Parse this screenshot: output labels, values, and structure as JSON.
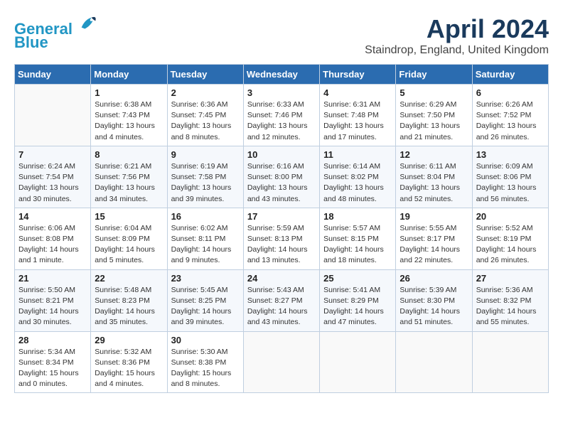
{
  "header": {
    "logo_line1": "General",
    "logo_line2": "Blue",
    "month_title": "April 2024",
    "location": "Staindrop, England, United Kingdom"
  },
  "weekdays": [
    "Sunday",
    "Monday",
    "Tuesday",
    "Wednesday",
    "Thursday",
    "Friday",
    "Saturday"
  ],
  "weeks": [
    [
      {
        "day": "",
        "info": ""
      },
      {
        "day": "1",
        "info": "Sunrise: 6:38 AM\nSunset: 7:43 PM\nDaylight: 13 hours\nand 4 minutes."
      },
      {
        "day": "2",
        "info": "Sunrise: 6:36 AM\nSunset: 7:45 PM\nDaylight: 13 hours\nand 8 minutes."
      },
      {
        "day": "3",
        "info": "Sunrise: 6:33 AM\nSunset: 7:46 PM\nDaylight: 13 hours\nand 12 minutes."
      },
      {
        "day": "4",
        "info": "Sunrise: 6:31 AM\nSunset: 7:48 PM\nDaylight: 13 hours\nand 17 minutes."
      },
      {
        "day": "5",
        "info": "Sunrise: 6:29 AM\nSunset: 7:50 PM\nDaylight: 13 hours\nand 21 minutes."
      },
      {
        "day": "6",
        "info": "Sunrise: 6:26 AM\nSunset: 7:52 PM\nDaylight: 13 hours\nand 26 minutes."
      }
    ],
    [
      {
        "day": "7",
        "info": "Sunrise: 6:24 AM\nSunset: 7:54 PM\nDaylight: 13 hours\nand 30 minutes."
      },
      {
        "day": "8",
        "info": "Sunrise: 6:21 AM\nSunset: 7:56 PM\nDaylight: 13 hours\nand 34 minutes."
      },
      {
        "day": "9",
        "info": "Sunrise: 6:19 AM\nSunset: 7:58 PM\nDaylight: 13 hours\nand 39 minutes."
      },
      {
        "day": "10",
        "info": "Sunrise: 6:16 AM\nSunset: 8:00 PM\nDaylight: 13 hours\nand 43 minutes."
      },
      {
        "day": "11",
        "info": "Sunrise: 6:14 AM\nSunset: 8:02 PM\nDaylight: 13 hours\nand 48 minutes."
      },
      {
        "day": "12",
        "info": "Sunrise: 6:11 AM\nSunset: 8:04 PM\nDaylight: 13 hours\nand 52 minutes."
      },
      {
        "day": "13",
        "info": "Sunrise: 6:09 AM\nSunset: 8:06 PM\nDaylight: 13 hours\nand 56 minutes."
      }
    ],
    [
      {
        "day": "14",
        "info": "Sunrise: 6:06 AM\nSunset: 8:08 PM\nDaylight: 14 hours\nand 1 minute."
      },
      {
        "day": "15",
        "info": "Sunrise: 6:04 AM\nSunset: 8:09 PM\nDaylight: 14 hours\nand 5 minutes."
      },
      {
        "day": "16",
        "info": "Sunrise: 6:02 AM\nSunset: 8:11 PM\nDaylight: 14 hours\nand 9 minutes."
      },
      {
        "day": "17",
        "info": "Sunrise: 5:59 AM\nSunset: 8:13 PM\nDaylight: 14 hours\nand 13 minutes."
      },
      {
        "day": "18",
        "info": "Sunrise: 5:57 AM\nSunset: 8:15 PM\nDaylight: 14 hours\nand 18 minutes."
      },
      {
        "day": "19",
        "info": "Sunrise: 5:55 AM\nSunset: 8:17 PM\nDaylight: 14 hours\nand 22 minutes."
      },
      {
        "day": "20",
        "info": "Sunrise: 5:52 AM\nSunset: 8:19 PM\nDaylight: 14 hours\nand 26 minutes."
      }
    ],
    [
      {
        "day": "21",
        "info": "Sunrise: 5:50 AM\nSunset: 8:21 PM\nDaylight: 14 hours\nand 30 minutes."
      },
      {
        "day": "22",
        "info": "Sunrise: 5:48 AM\nSunset: 8:23 PM\nDaylight: 14 hours\nand 35 minutes."
      },
      {
        "day": "23",
        "info": "Sunrise: 5:45 AM\nSunset: 8:25 PM\nDaylight: 14 hours\nand 39 minutes."
      },
      {
        "day": "24",
        "info": "Sunrise: 5:43 AM\nSunset: 8:27 PM\nDaylight: 14 hours\nand 43 minutes."
      },
      {
        "day": "25",
        "info": "Sunrise: 5:41 AM\nSunset: 8:29 PM\nDaylight: 14 hours\nand 47 minutes."
      },
      {
        "day": "26",
        "info": "Sunrise: 5:39 AM\nSunset: 8:30 PM\nDaylight: 14 hours\nand 51 minutes."
      },
      {
        "day": "27",
        "info": "Sunrise: 5:36 AM\nSunset: 8:32 PM\nDaylight: 14 hours\nand 55 minutes."
      }
    ],
    [
      {
        "day": "28",
        "info": "Sunrise: 5:34 AM\nSunset: 8:34 PM\nDaylight: 15 hours\nand 0 minutes."
      },
      {
        "day": "29",
        "info": "Sunrise: 5:32 AM\nSunset: 8:36 PM\nDaylight: 15 hours\nand 4 minutes."
      },
      {
        "day": "30",
        "info": "Sunrise: 5:30 AM\nSunset: 8:38 PM\nDaylight: 15 hours\nand 8 minutes."
      },
      {
        "day": "",
        "info": ""
      },
      {
        "day": "",
        "info": ""
      },
      {
        "day": "",
        "info": ""
      },
      {
        "day": "",
        "info": ""
      }
    ]
  ]
}
